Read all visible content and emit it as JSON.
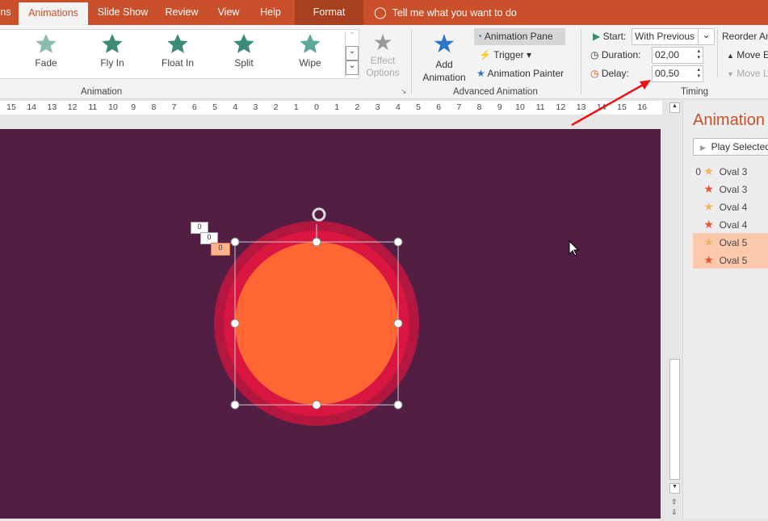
{
  "tabs": [
    {
      "label": "ns"
    },
    {
      "label": "Animations",
      "active": true
    },
    {
      "label": "Slide Show"
    },
    {
      "label": "Review"
    },
    {
      "label": "View"
    },
    {
      "label": "Help"
    },
    {
      "label": "Format"
    }
  ],
  "tell_me": "Tell me what you want to do",
  "gallery": [
    {
      "label": "Fade"
    },
    {
      "label": "Fly In"
    },
    {
      "label": "Float In"
    },
    {
      "label": "Split"
    },
    {
      "label": "Wipe"
    }
  ],
  "effect_options": "Effect Options",
  "group_animation": "Animation",
  "advanced": {
    "add_animation": "Add Animation",
    "animation_pane": "Animation Pane",
    "trigger": "Trigger",
    "painter": "Animation Painter",
    "group": "Advanced Animation"
  },
  "timing": {
    "start_label": "Start:",
    "start_value": "With Previous",
    "duration_label": "Duration:",
    "duration_value": "02,00",
    "delay_label": "Delay:",
    "delay_value": "00,50",
    "group": "Timing",
    "reorder": "Reorder An",
    "move_earlier": "Move E",
    "move_later": "Move L"
  },
  "ruler": [
    "15",
    "14",
    "13",
    "12",
    "11",
    "10",
    "9",
    "8",
    "7",
    "6",
    "5",
    "4",
    "3",
    "2",
    "1",
    "0",
    "1",
    "2",
    "3",
    "4",
    "5",
    "6",
    "7",
    "8",
    "9",
    "10",
    "11",
    "12",
    "13",
    "14",
    "15",
    "16"
  ],
  "tags": [
    "0",
    "0",
    "0"
  ],
  "pane": {
    "title": "Animation",
    "play": "Play Selected",
    "items": [
      {
        "num": "0",
        "label": "Oval 3",
        "type": "entrance"
      },
      {
        "label": "Oval 3",
        "type": "emphasis"
      },
      {
        "label": "Oval 4",
        "type": "entrance"
      },
      {
        "label": "Oval 4",
        "type": "emphasis"
      },
      {
        "label": "Oval 5",
        "type": "entrance",
        "selected": true
      },
      {
        "label": "Oval 5",
        "type": "emphasis",
        "selected": true
      }
    ]
  },
  "colors": {
    "accent": "#c9502a",
    "slide": "#521e44",
    "circle": "#ff6633",
    "ring": "#d9163f"
  }
}
